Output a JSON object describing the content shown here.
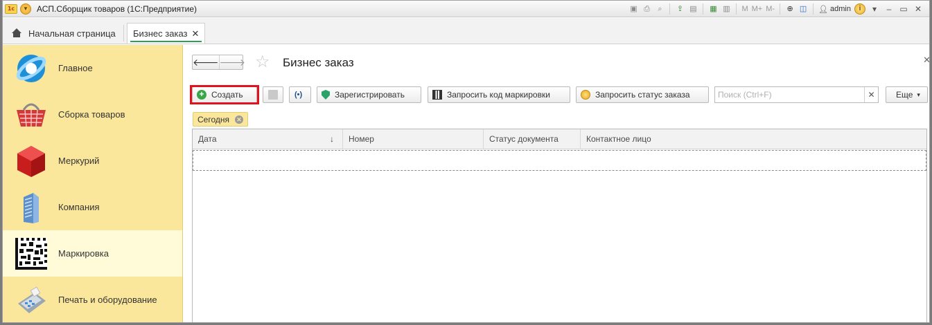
{
  "window": {
    "logo": "1c",
    "title": "АСП.Сборщик товаров  (1С:Предприятие)",
    "toolbar_letters": [
      "M",
      "M+",
      "M-"
    ],
    "user": "admin"
  },
  "tabs": {
    "home_label": "Начальная страница",
    "active_label": "Бизнес заказ"
  },
  "sidebar": {
    "items": [
      {
        "label": "Главное",
        "icon": "main-section-icon"
      },
      {
        "label": "Сборка товаров",
        "icon": "basket-icon"
      },
      {
        "label": "Меркурий",
        "icon": "red-cube-icon"
      },
      {
        "label": "Компания",
        "icon": "building-icon"
      },
      {
        "label": "Маркировка",
        "icon": "datamatrix-icon"
      },
      {
        "label": "Печать и оборудование",
        "icon": "card-terminal-icon"
      }
    ],
    "selected_index": 4
  },
  "form": {
    "title": "Бизнес заказ",
    "buttons": {
      "create": "Создать",
      "register": "Зарегистрировать",
      "request_code": "Запросить код маркировки",
      "request_status": "Запросить статус заказа",
      "more": "Еще"
    },
    "search": {
      "placeholder": "Поиск (Ctrl+F)",
      "value": ""
    },
    "filter_chip": "Сегодня",
    "grid": {
      "columns": [
        "Дата",
        "Номер",
        "Статус документа",
        "Контактное лицо"
      ],
      "sort_column": "Дата",
      "rows": []
    }
  },
  "colors": {
    "sidebar_bg": "#fbe79c",
    "sidebar_selected": "#fffbd8",
    "tab_accent": "#2e9f57",
    "highlight": "#e0121d"
  }
}
